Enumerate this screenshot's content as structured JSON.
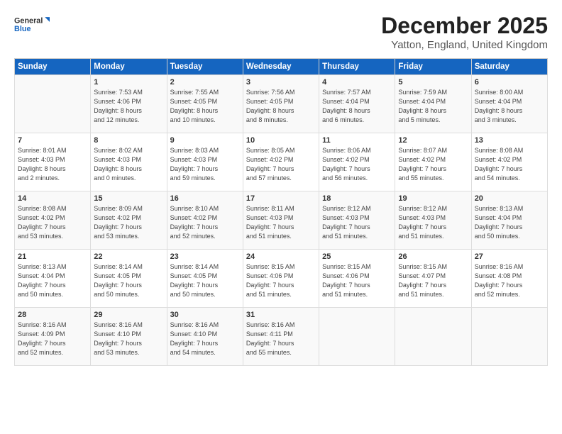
{
  "logo": {
    "line1": "General",
    "line2": "Blue"
  },
  "title": "December 2025",
  "subtitle": "Yatton, England, United Kingdom",
  "days_header": [
    "Sunday",
    "Monday",
    "Tuesday",
    "Wednesday",
    "Thursday",
    "Friday",
    "Saturday"
  ],
  "weeks": [
    [
      {
        "day": "",
        "info": ""
      },
      {
        "day": "1",
        "info": "Sunrise: 7:53 AM\nSunset: 4:06 PM\nDaylight: 8 hours\nand 12 minutes."
      },
      {
        "day": "2",
        "info": "Sunrise: 7:55 AM\nSunset: 4:05 PM\nDaylight: 8 hours\nand 10 minutes."
      },
      {
        "day": "3",
        "info": "Sunrise: 7:56 AM\nSunset: 4:05 PM\nDaylight: 8 hours\nand 8 minutes."
      },
      {
        "day": "4",
        "info": "Sunrise: 7:57 AM\nSunset: 4:04 PM\nDaylight: 8 hours\nand 6 minutes."
      },
      {
        "day": "5",
        "info": "Sunrise: 7:59 AM\nSunset: 4:04 PM\nDaylight: 8 hours\nand 5 minutes."
      },
      {
        "day": "6",
        "info": "Sunrise: 8:00 AM\nSunset: 4:04 PM\nDaylight: 8 hours\nand 3 minutes."
      }
    ],
    [
      {
        "day": "7",
        "info": "Sunrise: 8:01 AM\nSunset: 4:03 PM\nDaylight: 8 hours\nand 2 minutes."
      },
      {
        "day": "8",
        "info": "Sunrise: 8:02 AM\nSunset: 4:03 PM\nDaylight: 8 hours\nand 0 minutes."
      },
      {
        "day": "9",
        "info": "Sunrise: 8:03 AM\nSunset: 4:03 PM\nDaylight: 7 hours\nand 59 minutes."
      },
      {
        "day": "10",
        "info": "Sunrise: 8:05 AM\nSunset: 4:02 PM\nDaylight: 7 hours\nand 57 minutes."
      },
      {
        "day": "11",
        "info": "Sunrise: 8:06 AM\nSunset: 4:02 PM\nDaylight: 7 hours\nand 56 minutes."
      },
      {
        "day": "12",
        "info": "Sunrise: 8:07 AM\nSunset: 4:02 PM\nDaylight: 7 hours\nand 55 minutes."
      },
      {
        "day": "13",
        "info": "Sunrise: 8:08 AM\nSunset: 4:02 PM\nDaylight: 7 hours\nand 54 minutes."
      }
    ],
    [
      {
        "day": "14",
        "info": "Sunrise: 8:08 AM\nSunset: 4:02 PM\nDaylight: 7 hours\nand 53 minutes."
      },
      {
        "day": "15",
        "info": "Sunrise: 8:09 AM\nSunset: 4:02 PM\nDaylight: 7 hours\nand 53 minutes."
      },
      {
        "day": "16",
        "info": "Sunrise: 8:10 AM\nSunset: 4:02 PM\nDaylight: 7 hours\nand 52 minutes."
      },
      {
        "day": "17",
        "info": "Sunrise: 8:11 AM\nSunset: 4:03 PM\nDaylight: 7 hours\nand 51 minutes."
      },
      {
        "day": "18",
        "info": "Sunrise: 8:12 AM\nSunset: 4:03 PM\nDaylight: 7 hours\nand 51 minutes."
      },
      {
        "day": "19",
        "info": "Sunrise: 8:12 AM\nSunset: 4:03 PM\nDaylight: 7 hours\nand 51 minutes."
      },
      {
        "day": "20",
        "info": "Sunrise: 8:13 AM\nSunset: 4:04 PM\nDaylight: 7 hours\nand 50 minutes."
      }
    ],
    [
      {
        "day": "21",
        "info": "Sunrise: 8:13 AM\nSunset: 4:04 PM\nDaylight: 7 hours\nand 50 minutes."
      },
      {
        "day": "22",
        "info": "Sunrise: 8:14 AM\nSunset: 4:05 PM\nDaylight: 7 hours\nand 50 minutes."
      },
      {
        "day": "23",
        "info": "Sunrise: 8:14 AM\nSunset: 4:05 PM\nDaylight: 7 hours\nand 50 minutes."
      },
      {
        "day": "24",
        "info": "Sunrise: 8:15 AM\nSunset: 4:06 PM\nDaylight: 7 hours\nand 51 minutes."
      },
      {
        "day": "25",
        "info": "Sunrise: 8:15 AM\nSunset: 4:06 PM\nDaylight: 7 hours\nand 51 minutes."
      },
      {
        "day": "26",
        "info": "Sunrise: 8:15 AM\nSunset: 4:07 PM\nDaylight: 7 hours\nand 51 minutes."
      },
      {
        "day": "27",
        "info": "Sunrise: 8:16 AM\nSunset: 4:08 PM\nDaylight: 7 hours\nand 52 minutes."
      }
    ],
    [
      {
        "day": "28",
        "info": "Sunrise: 8:16 AM\nSunset: 4:09 PM\nDaylight: 7 hours\nand 52 minutes."
      },
      {
        "day": "29",
        "info": "Sunrise: 8:16 AM\nSunset: 4:10 PM\nDaylight: 7 hours\nand 53 minutes."
      },
      {
        "day": "30",
        "info": "Sunrise: 8:16 AM\nSunset: 4:10 PM\nDaylight: 7 hours\nand 54 minutes."
      },
      {
        "day": "31",
        "info": "Sunrise: 8:16 AM\nSunset: 4:11 PM\nDaylight: 7 hours\nand 55 minutes."
      },
      {
        "day": "",
        "info": ""
      },
      {
        "day": "",
        "info": ""
      },
      {
        "day": "",
        "info": ""
      }
    ]
  ]
}
